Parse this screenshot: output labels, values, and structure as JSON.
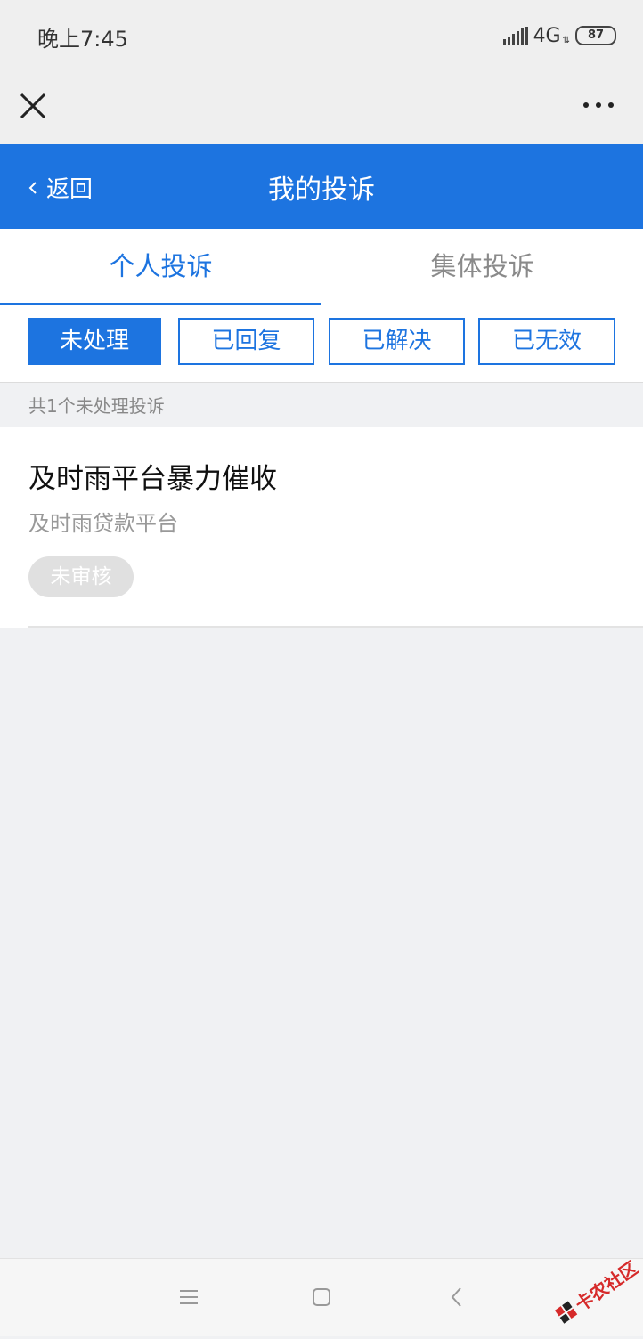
{
  "status_bar": {
    "time": "晚上7:45",
    "network": "4G",
    "battery": "87"
  },
  "header": {
    "back_label": "返回",
    "title": "我的投诉",
    "color": "#1d74e0"
  },
  "tabs": [
    {
      "label": "个人投诉",
      "active": true
    },
    {
      "label": "集体投诉",
      "active": false
    }
  ],
  "filters": [
    {
      "label": "未处理",
      "active": true
    },
    {
      "label": "已回复",
      "active": false
    },
    {
      "label": "已解决",
      "active": false
    },
    {
      "label": "已无效",
      "active": false
    }
  ],
  "count_text": "共1个未处理投诉",
  "complaints": [
    {
      "title": "及时雨平台暴力催收",
      "subtitle": "及时雨贷款平台",
      "status": "未审核"
    }
  ],
  "nav_bar": {
    "buttons": [
      "menu-icon",
      "home-icon",
      "back-icon"
    ]
  },
  "watermark": {
    "text": "卡农社区"
  }
}
